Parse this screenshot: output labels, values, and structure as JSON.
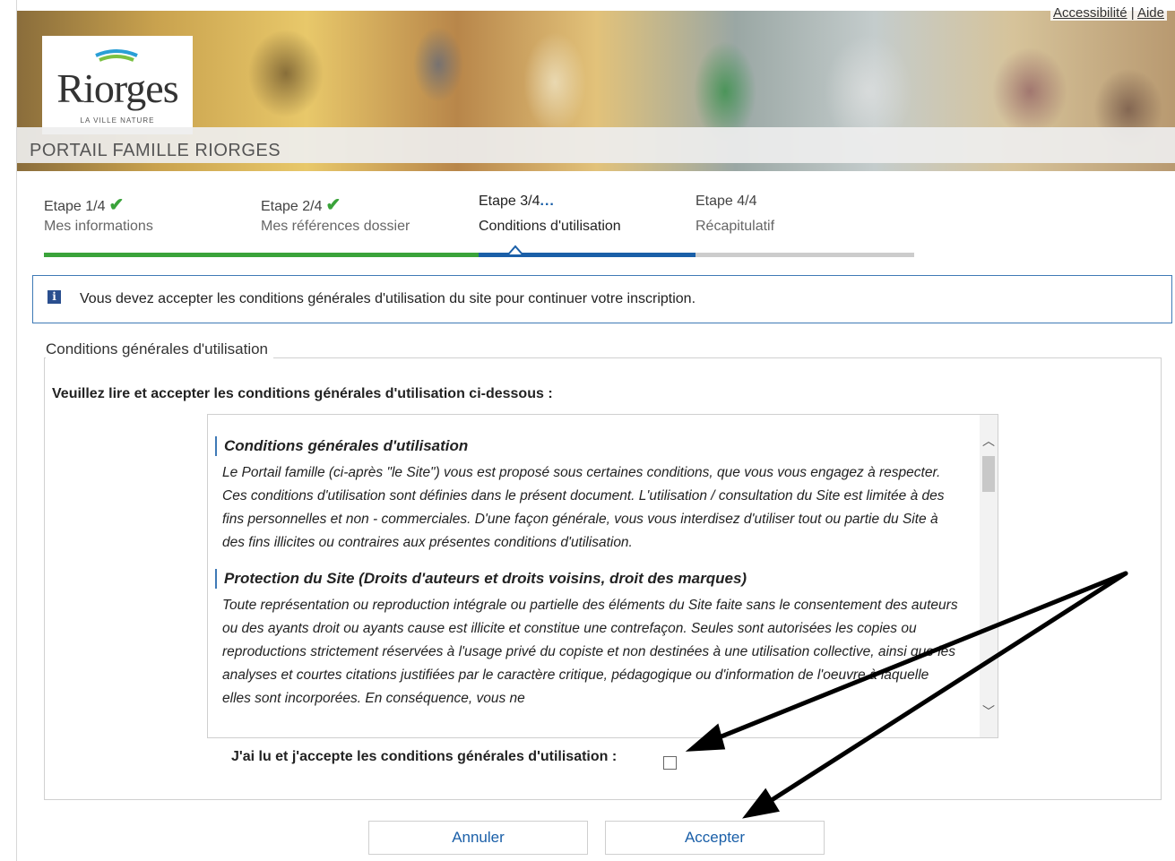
{
  "header": {
    "logo_name": "Riorges",
    "logo_tagline": "LA VILLE NATURE",
    "portal_title": "PORTAIL FAMILLE RIORGES",
    "links": {
      "accessibility": "Accessibilité",
      "separator": "|",
      "help": "Aide"
    }
  },
  "steps": [
    {
      "number": "Etape 1/4",
      "label": "Mes informations",
      "status": "done"
    },
    {
      "number": "Etape 2/4",
      "label": "Mes références dossier",
      "status": "done"
    },
    {
      "number": "Etape 3/4",
      "label": "Conditions d'utilisation",
      "status": "current",
      "dots": "..."
    },
    {
      "number": "Etape 4/4",
      "label": "Récapitulatif",
      "status": "pending"
    }
  ],
  "progress_colors": {
    "done": "#3aa33a",
    "current": "#1a5fa8",
    "pending": "#cccccc"
  },
  "info": {
    "icon": "info-icon",
    "text": "Vous devez accepter les conditions générales d'utilisation du site pour continuer votre inscription."
  },
  "terms": {
    "legend": "Conditions générales d'utilisation",
    "prompt": "Veuillez lire et accepter les conditions générales d'utilisation ci-dessous :",
    "sections": [
      {
        "title": "Conditions générales d'utilisation",
        "body": "Le Portail famille (ci-après \"le Site\") vous est proposé sous certaines conditions, que vous vous engagez à respecter. Ces conditions d'utilisation sont définies dans le présent document. L'utilisation / consultation du Site est limitée à des fins personnelles et non - commerciales. D'une façon générale, vous vous interdisez d'utiliser tout ou partie du Site à des fins illicites ou contraires aux présentes conditions d'utilisation."
      },
      {
        "title": "Protection du Site (Droits d'auteurs et droits voisins, droit des marques)",
        "body": "Toute représentation ou reproduction intégrale ou partielle des éléments du Site faite sans le consentement des auteurs ou des ayants droit ou ayants cause est illicite et constitue une contrefaçon. Seules sont autorisées les copies ou reproductions strictement réservées à l'usage privé du copiste et non destinées à une utilisation collective, ainsi que les analyses et courtes citations justifiées par le caractère critique, pédagogique ou d'information de l'oeuvre à laquelle elles sont incorporées. En conséquence, vous ne"
      }
    ],
    "accept_label": "J'ai lu et j'accepte les conditions générales d'utilisation :",
    "accept_checked": false
  },
  "buttons": {
    "cancel": "Annuler",
    "accept": "Accepter"
  },
  "annotation_color": "#000000"
}
